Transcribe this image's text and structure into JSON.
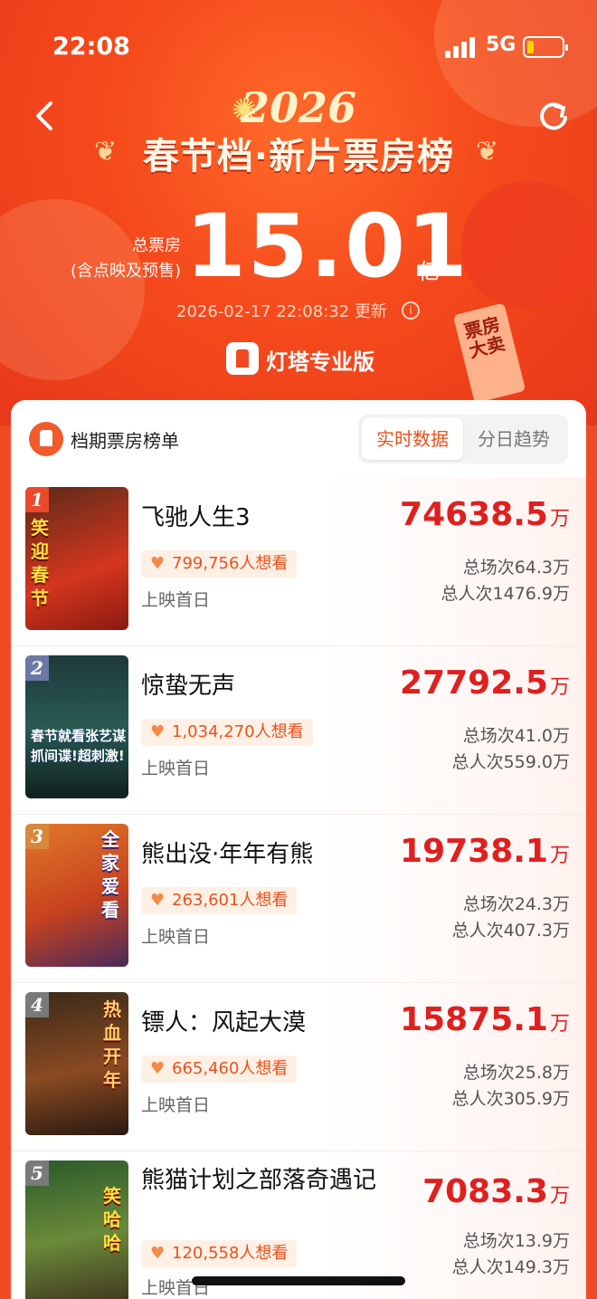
{
  "status_bar": {
    "time": "22:08",
    "network": "5G"
  },
  "header": {
    "year": "2026",
    "title": "春节档·新片票房榜",
    "total_label_1": "总票房",
    "total_label_2": "(含点映及预售)",
    "total_value": "15.01",
    "total_unit": "亿",
    "update_time": "2026-02-17 22:08:32 更新",
    "brand_name": "灯塔专业版",
    "tag_text": "票房大卖"
  },
  "card": {
    "title": "档期票房榜单",
    "tabs": [
      {
        "label": "实时数据",
        "active": true
      },
      {
        "label": "分日趋势",
        "active": false
      }
    ]
  },
  "movies": [
    {
      "rank": "1",
      "title": "飞驰人生3",
      "want": "799,756人想看",
      "release": "上映首日",
      "box_value": "74638.5",
      "box_unit": "万",
      "sessions": "总场次64.3万",
      "viewers": "总人次1476.9万",
      "poster_text": "笑迎春节",
      "rank_color": "#e84a2a"
    },
    {
      "rank": "2",
      "title": "惊蛰无声",
      "want": "1,034,270人想看",
      "release": "上映首日",
      "box_value": "27792.5",
      "box_unit": "万",
      "sessions": "总场次41.0万",
      "viewers": "总人次559.0万",
      "poster_text": "春节就看张艺谋 抓间谍!超刺激!",
      "rank_color": "#6b78a8"
    },
    {
      "rank": "3",
      "title": "熊出没·年年有熊",
      "want": "263,601人想看",
      "release": "上映首日",
      "box_value": "19738.1",
      "box_unit": "万",
      "sessions": "总场次24.3万",
      "viewers": "总人次407.3万",
      "poster_text": "全家爱看",
      "rank_color": "#d9873a"
    },
    {
      "rank": "4",
      "title": "镖人：风起大漠",
      "want": "665,460人想看",
      "release": "上映首日",
      "box_value": "15875.1",
      "box_unit": "万",
      "sessions": "总场次25.8万",
      "viewers": "总人次305.9万",
      "poster_text": "热血开年",
      "rank_color": "#7a7a7a"
    },
    {
      "rank": "5",
      "title": "熊猫计划之部落奇遇记",
      "want": "120,558人想看",
      "release": "上映首日",
      "box_value": "7083.3",
      "box_unit": "万",
      "sessions": "总场次13.9万",
      "viewers": "总人次149.3万",
      "poster_text": "笑哈哈",
      "rank_color": "#7a7a7a"
    }
  ]
}
